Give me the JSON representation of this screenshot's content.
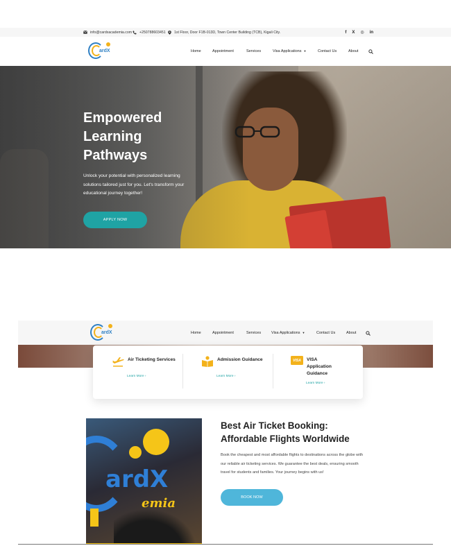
{
  "topbar": {
    "email": "info@cardxacademia.com",
    "phone": "+250788603451",
    "address": "1st Floor, Door F1B-013D, Town Center Building (TCB), Kigali City.",
    "social": [
      "f",
      "X",
      "◎",
      "in"
    ]
  },
  "logo": {
    "text": "ardX"
  },
  "nav": {
    "items": [
      "Home",
      "Appointment",
      "Services",
      "Visa Applications",
      "Contact Us",
      "About"
    ]
  },
  "hero": {
    "title": "Empowered Learning Pathways",
    "subtitle": "Unlock your potential with personalized learning solutions tailored just for you. Let's transform your educational journey together!",
    "button": "APPLY NOW"
  },
  "services": [
    {
      "title": "Air Ticketing Services",
      "link": "Learn More",
      "icon": "airplane-icon"
    },
    {
      "title": "Admission Guidance",
      "link": "Learn More",
      "icon": "reading-person-icon"
    },
    {
      "title": "VISA Application Guidance",
      "link": "Learn More",
      "icon": "visa-card-icon",
      "icon_text": "VISA"
    }
  ],
  "about": {
    "heading": "Best Air Ticket Booking: Affordable Flights Worldwide",
    "body": "Book the cheapest and most affordable flights to destinations across the globe with our reliable air ticketing services. We guarantee the best deals, ensuring smooth travel for students and families. Your journey begins with us!",
    "button": "BOOK NOW",
    "photo_text_main": "ardX",
    "photo_text_sub": "emia"
  },
  "colors": {
    "teal": "#1fa3a4",
    "light_blue": "#4fb6da",
    "brand_blue": "#2f80c4",
    "brand_yellow": "#f3b21b"
  }
}
